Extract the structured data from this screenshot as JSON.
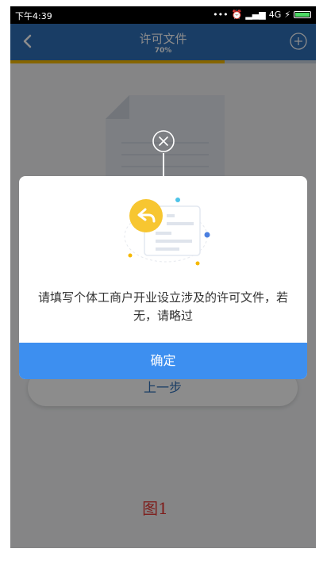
{
  "status_bar": {
    "time": "下午4:39",
    "network": "4G"
  },
  "header": {
    "title": "许可文件",
    "progress_text": "70%",
    "progress": 0.7,
    "back_icon": "chevron-left-icon",
    "add_icon": "plus-circle-icon"
  },
  "content": {
    "prev_label": "上一步",
    "caption": "图1"
  },
  "dialog": {
    "message": "请填写个体工商户开业设立涉及的许可文件，若无，请略过",
    "confirm_label": "确定",
    "close_icon": "close-circle-icon"
  },
  "colors": {
    "nav": "#2f6fb8",
    "progress": "#f5b800",
    "confirm": "#3d8ff0",
    "caption": "#e53935"
  }
}
